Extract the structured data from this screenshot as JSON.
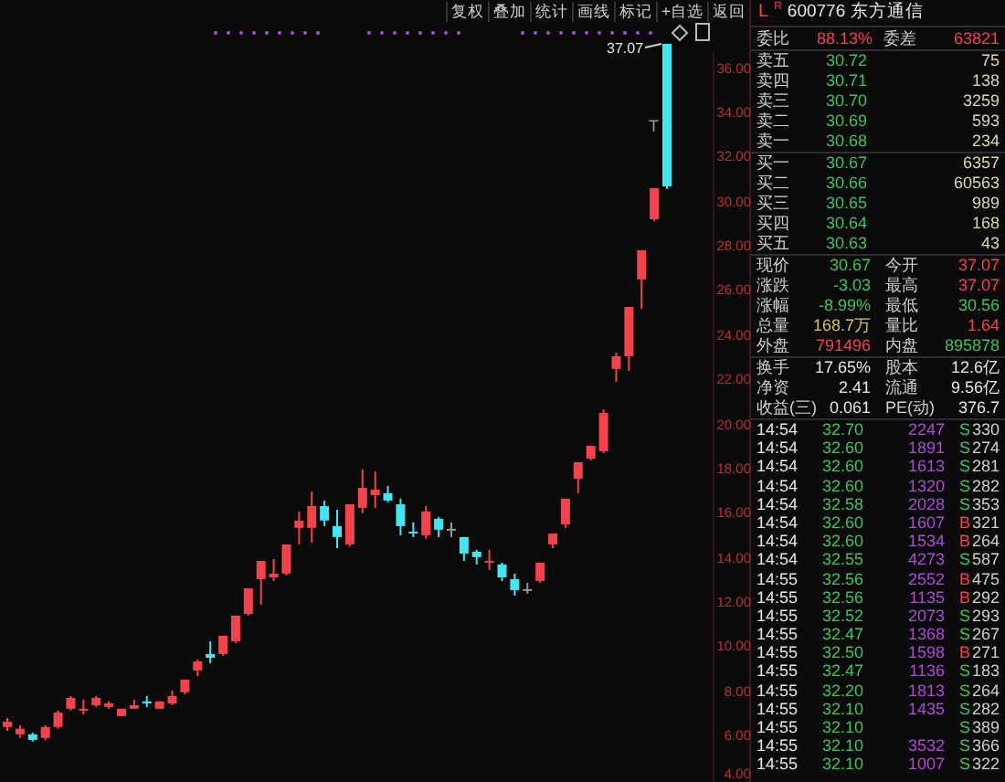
{
  "toolbar": {
    "buttons": [
      "复权",
      "叠加",
      "统计",
      "画线",
      "标记",
      "+自选",
      "返回"
    ]
  },
  "chart": {
    "high_label": "37.07",
    "marker": "T",
    "chart_data": {
      "type": "candlestick",
      "ylim": [
        3.92,
        36.74
      ],
      "ohlc": [
        [
          6.39,
          6.8,
          6.22,
          6.63
        ],
        [
          6.06,
          6.47,
          5.9,
          6.31
        ],
        [
          6.06,
          6.14,
          5.73,
          5.81
        ],
        [
          5.9,
          6.47,
          5.81,
          6.39
        ],
        [
          6.39,
          7.13,
          6.31,
          7.04
        ],
        [
          7.21,
          7.78,
          7.13,
          7.7
        ],
        [
          7.13,
          7.62,
          6.96,
          7.21
        ],
        [
          7.37,
          7.78,
          7.29,
          7.7
        ],
        [
          7.29,
          7.54,
          7.21,
          7.45
        ],
        [
          6.88,
          7.21,
          6.88,
          7.21
        ],
        [
          7.21,
          7.62,
          7.21,
          7.37
        ],
        [
          7.54,
          7.78,
          7.29,
          7.45
        ],
        [
          7.21,
          7.54,
          7.21,
          7.54
        ],
        [
          7.45,
          8.03,
          7.37,
          7.78
        ],
        [
          7.95,
          8.52,
          7.86,
          8.52
        ],
        [
          8.93,
          9.42,
          8.68,
          9.34
        ],
        [
          9.67,
          10.24,
          9.26,
          9.5
        ],
        [
          9.67,
          10.49,
          9.59,
          10.49
        ],
        [
          10.24,
          11.39,
          10.16,
          11.39
        ],
        [
          11.47,
          12.62,
          11.39,
          12.62
        ],
        [
          13.03,
          13.85,
          11.88,
          13.85
        ],
        [
          13.11,
          13.93,
          12.95,
          13.28
        ],
        [
          13.28,
          14.59,
          13.2,
          14.59
        ],
        [
          15.33,
          16.07,
          14.59,
          15.66
        ],
        [
          15.33,
          16.97,
          14.67,
          16.31
        ],
        [
          16.31,
          16.56,
          15.41,
          15.66
        ],
        [
          15.41,
          16.15,
          14.42,
          14.92
        ],
        [
          14.59,
          16.39,
          14.51,
          16.39
        ],
        [
          16.23,
          17.95,
          15.99,
          17.13
        ],
        [
          16.8,
          17.87,
          16.23,
          17.05
        ],
        [
          16.89,
          17.21,
          16.48,
          16.56
        ],
        [
          16.39,
          16.64,
          15.0,
          15.41
        ],
        [
          15.16,
          15.58,
          14.92,
          15.08
        ],
        [
          15.0,
          16.31,
          14.84,
          16.07
        ],
        [
          15.74,
          15.82,
          14.92,
          15.25
        ],
        [
          15.29,
          15.58,
          14.92,
          15.29
        ],
        [
          14.92,
          14.92,
          13.85,
          14.18
        ],
        [
          14.26,
          14.35,
          13.69,
          14.02
        ],
        [
          13.77,
          14.35,
          13.44,
          13.85
        ],
        [
          13.69,
          13.77,
          12.95,
          13.11
        ],
        [
          13.03,
          13.28,
          12.29,
          12.54
        ],
        [
          12.58,
          12.87,
          12.38,
          12.58
        ],
        [
          12.95,
          13.77,
          12.87,
          13.77
        ],
        [
          14.59,
          15.08,
          14.42,
          15.08
        ],
        [
          15.49,
          16.64,
          15.33,
          16.64
        ],
        [
          17.54,
          18.28,
          16.89,
          18.28
        ],
        [
          18.44,
          19.02,
          18.36,
          19.02
        ],
        [
          18.77,
          20.66,
          18.69,
          20.5
        ],
        [
          22.47,
          23.2,
          21.89,
          23.04
        ],
        [
          23.04,
          25.25,
          22.38,
          25.25
        ],
        [
          26.49,
          27.8,
          25.17,
          27.8
        ],
        [
          29.19,
          30.59,
          29.11,
          30.59
        ],
        [
          37.07,
          37.07,
          30.56,
          30.67
        ]
      ],
      "yticks": [
        {
          "value": 36,
          "label": "36.00"
        },
        {
          "value": 34,
          "label": "34.00"
        },
        {
          "value": 32,
          "label": "32.00"
        },
        {
          "value": 30,
          "label": "30.00"
        },
        {
          "value": 28,
          "label": "28.00"
        },
        {
          "value": 26,
          "label": "26.00"
        },
        {
          "value": 24,
          "label": "24.00"
        },
        {
          "value": 22,
          "label": "22.00"
        },
        {
          "value": 20,
          "label": "20.00"
        },
        {
          "value": 18,
          "label": "18.00"
        },
        {
          "value": 16,
          "label": "16.00"
        },
        {
          "value": 14,
          "label": "14.00"
        },
        {
          "value": 12,
          "label": "12.00"
        },
        {
          "value": 10,
          "label": "10.00"
        },
        {
          "value": 8,
          "label": "8.00"
        },
        {
          "value": 6,
          "label": "6.00"
        },
        {
          "value": 4,
          "label": "4.00"
        }
      ]
    }
  },
  "quote": {
    "indicator": "L",
    "badge": "R",
    "code": "600776",
    "name": "东方通信"
  },
  "order_ratio": [
    {
      "label": "委比",
      "value": "88.13%"
    },
    {
      "label": "委差",
      "value": "63821"
    }
  ],
  "order_book": [
    {
      "label": "卖五",
      "price": "30.72",
      "volume": "75"
    },
    {
      "label": "卖四",
      "price": "30.71",
      "volume": "138"
    },
    {
      "label": "卖三",
      "price": "30.70",
      "volume": "3259"
    },
    {
      "label": "卖二",
      "price": "30.69",
      "volume": "593"
    },
    {
      "label": "卖一",
      "price": "30.68",
      "volume": "234"
    },
    {
      "label": "买一",
      "price": "30.67",
      "volume": "6357"
    },
    {
      "label": "买二",
      "price": "30.66",
      "volume": "60563"
    },
    {
      "label": "买三",
      "price": "30.65",
      "volume": "989"
    },
    {
      "label": "买四",
      "price": "30.64",
      "volume": "168"
    },
    {
      "label": "买五",
      "price": "30.63",
      "volume": "43"
    }
  ],
  "stat_groups": [
    [
      {
        "label": "现价",
        "value": "30.67",
        "color": "#3cc35a"
      },
      {
        "label": "今开",
        "value": "37.07",
        "color": "#f0434b"
      },
      {
        "label": "涨跌",
        "value": "-3.03",
        "color": "#3cc35a"
      },
      {
        "label": "最高",
        "value": "37.07",
        "color": "#f0434b"
      },
      {
        "label": "涨幅",
        "value": "-8.99%",
        "color": "#3cc35a"
      },
      {
        "label": "最低",
        "value": "30.56",
        "color": "#3cc35a"
      },
      {
        "label": "总量",
        "value": "168.7万",
        "color": "#d8c060"
      },
      {
        "label": "量比",
        "value": "1.64",
        "color": "#f0434b"
      },
      {
        "label": "外盘",
        "value": "791496",
        "color": "#f0434b"
      },
      {
        "label": "内盘",
        "value": "895878",
        "color": "#3cc35a"
      }
    ],
    [
      {
        "label": "换手",
        "value": "17.65%",
        "color": "#e6e6e6"
      },
      {
        "label": "股本",
        "value": "12.6亿",
        "color": "#e6e6e6"
      },
      {
        "label": "净资",
        "value": "2.41",
        "color": "#e6e6e6"
      },
      {
        "label": "流通",
        "value": "9.56亿",
        "color": "#e6e6e6"
      },
      {
        "label": "收益(三)",
        "value": "0.061",
        "color": "#e6e6e6"
      },
      {
        "label": "PE(动)",
        "value": "376.7",
        "color": "#e6e6e6"
      }
    ]
  ],
  "trades": [
    {
      "time": "14:54",
      "price": "32.70",
      "volume": "2247",
      "side": "S",
      "count": "330",
      "kind": "sell"
    },
    {
      "time": "14:54",
      "price": "32.60",
      "volume": "1891",
      "side": "S",
      "count": "274",
      "kind": "sell"
    },
    {
      "time": "14:54",
      "price": "32.60",
      "volume": "1613",
      "side": "S",
      "count": "281",
      "kind": "sell"
    },
    {
      "time": "14:54",
      "price": "32.60",
      "volume": "1320",
      "side": "S",
      "count": "282",
      "kind": "sell"
    },
    {
      "time": "14:54",
      "price": "32.58",
      "volume": "2028",
      "side": "S",
      "count": "353",
      "kind": "sell"
    },
    {
      "time": "14:54",
      "price": "32.60",
      "volume": "1607",
      "side": "B",
      "count": "321",
      "kind": "buy"
    },
    {
      "time": "14:54",
      "price": "32.60",
      "volume": "1534",
      "side": "B",
      "count": "264",
      "kind": "buy"
    },
    {
      "time": "14:54",
      "price": "32.55",
      "volume": "4273",
      "side": "S",
      "count": "587",
      "kind": "sell"
    },
    {
      "time": "14:55",
      "price": "32.56",
      "volume": "2552",
      "side": "B",
      "count": "475",
      "kind": "buy"
    },
    {
      "time": "14:55",
      "price": "32.56",
      "volume": "1135",
      "side": "B",
      "count": "292",
      "kind": "buy"
    },
    {
      "time": "14:55",
      "price": "32.52",
      "volume": "2073",
      "side": "S",
      "count": "293",
      "kind": "sell"
    },
    {
      "time": "14:55",
      "price": "32.47",
      "volume": "1368",
      "side": "S",
      "count": "267",
      "kind": "sell"
    },
    {
      "time": "14:55",
      "price": "32.50",
      "volume": "1598",
      "side": "B",
      "count": "271",
      "kind": "buy"
    },
    {
      "time": "14:55",
      "price": "32.47",
      "volume": "1136",
      "side": "S",
      "count": "183",
      "kind": "sell"
    },
    {
      "time": "14:55",
      "price": "32.20",
      "volume": "1813",
      "side": "S",
      "count": "264",
      "kind": "sell"
    },
    {
      "time": "14:55",
      "price": "32.10",
      "volume": "1435",
      "side": "S",
      "count": "282",
      "kind": "sell"
    },
    {
      "time": "14:55",
      "price": "32.10",
      "side": "S",
      "count": "389",
      "kind": "sell"
    },
    {
      "time": "14:55",
      "price": "32.10",
      "volume": "3532",
      "side": "S",
      "count": "366",
      "kind": "sell"
    },
    {
      "time": "14:55",
      "price": "32.10",
      "volume": "1007",
      "side": "S",
      "count": "322",
      "kind": "sell"
    }
  ]
}
